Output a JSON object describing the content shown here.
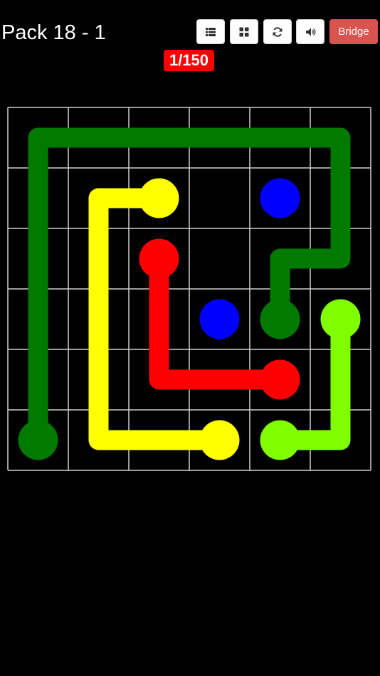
{
  "header": {
    "title": "Pack 18 - 1",
    "level_indicator": "1/150",
    "bridge_label": "Bridge",
    "toolbar_icons": [
      "list-icon",
      "grid-icon",
      "refresh-icon",
      "volume-icon"
    ]
  },
  "colors": {
    "background": "#000000",
    "grid_line": "#cfcfcf",
    "bridge_button": "#d9534f",
    "level_badge": "#ff0000",
    "green": "#007a00",
    "yellow": "#ffff00",
    "red": "#ff0000",
    "blue": "#0000ff",
    "lime": "#7fff00"
  },
  "board": {
    "rows": 6,
    "cols": 6,
    "flows": [
      {
        "color": "green",
        "endpoints": [
          [
            0,
            5
          ],
          [
            4,
            3
          ]
        ],
        "path": [
          [
            0,
            5
          ],
          [
            0,
            0
          ],
          [
            5,
            0
          ],
          [
            5,
            2
          ],
          [
            4,
            2
          ],
          [
            4,
            3
          ]
        ]
      },
      {
        "color": "yellow",
        "endpoints": [
          [
            2,
            1
          ],
          [
            3,
            5
          ]
        ],
        "path": [
          [
            2,
            1
          ],
          [
            1,
            1
          ],
          [
            1,
            5
          ],
          [
            3,
            5
          ]
        ]
      },
      {
        "color": "red",
        "endpoints": [
          [
            2,
            2
          ],
          [
            4,
            4
          ]
        ],
        "path": [
          [
            2,
            2
          ],
          [
            2,
            4
          ],
          [
            4,
            4
          ]
        ]
      },
      {
        "color": "lime",
        "endpoints": [
          [
            4,
            5
          ],
          [
            5,
            3
          ]
        ],
        "path": [
          [
            4,
            5
          ],
          [
            5,
            5
          ],
          [
            5,
            3
          ]
        ]
      },
      {
        "color": "blue",
        "endpoints": [
          [
            3,
            3
          ],
          [
            4,
            1
          ]
        ],
        "path": []
      }
    ]
  }
}
